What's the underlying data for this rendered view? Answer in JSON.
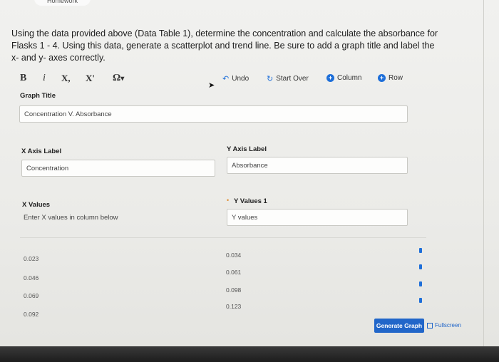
{
  "header": {
    "tab_title": "Homework"
  },
  "question": {
    "text": "Using the data provided above (Data Table 1), determine the concentration and calculate the absorbance for Flasks 1 - 4. Using this data, generate a scatterplot and trend line.  Be sure to add a graph title and label the x- and y- axes correctly."
  },
  "toolbar": {
    "bold": "B",
    "italic": "i",
    "subscript": "X,",
    "superscript": "X'",
    "omega": "Ω",
    "undo": "Undo",
    "start_over": "Start Over",
    "column": "Column",
    "row": "Row"
  },
  "form": {
    "graph_title_label": "Graph Title",
    "graph_title_value": "Concentration V. Absorbance",
    "x_axis_label": "X Axis Label",
    "x_axis_value": "Concentration",
    "y_axis_label": "Y Axis Label",
    "y_axis_value": "Absorbance",
    "x_values_label": "X Values",
    "x_values_hint": "Enter X values in column below",
    "y_values_label": "Y Values 1",
    "y_values_placeholder": "Y values"
  },
  "x_values": [
    "0.023",
    "0.046",
    "0.069",
    "0.092"
  ],
  "y_values": [
    "0.034",
    "0.061",
    "0.098",
    "0.123"
  ],
  "actions": {
    "generate": "Generate Graph",
    "fullscreen": "Fullscreen"
  },
  "colors": {
    "accent": "#1e6fd9",
    "button": "#2166c9"
  }
}
